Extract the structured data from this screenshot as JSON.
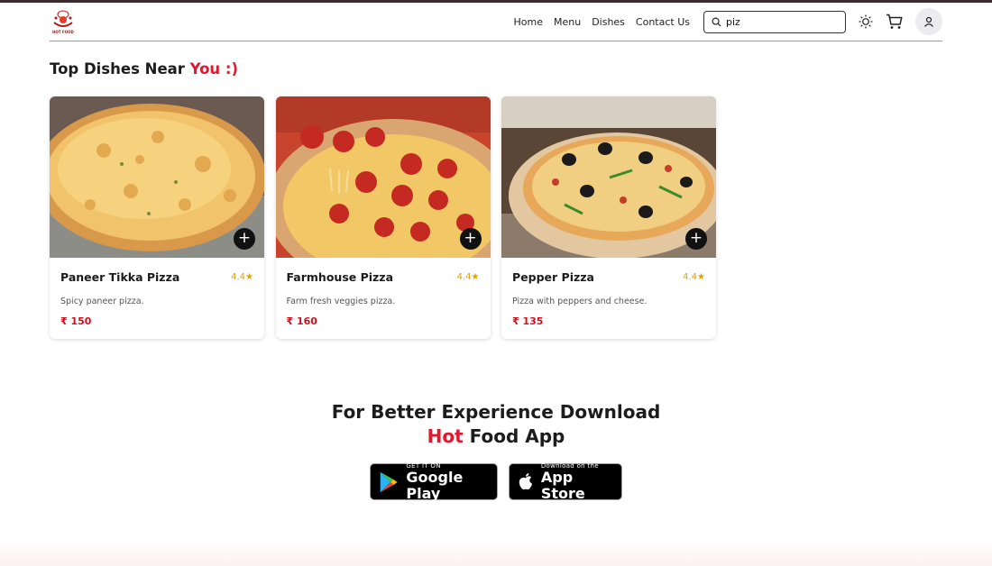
{
  "brand": {
    "logo_text": "HOT FOOD",
    "logo_icon": "chef-logo-icon"
  },
  "nav": {
    "links": [
      "Home",
      "Menu",
      "Dishes",
      "Contact Us"
    ],
    "search_value": "piz",
    "icons": [
      "search-icon",
      "sun-icon",
      "cart-icon",
      "user-icon"
    ]
  },
  "section": {
    "title_prefix": "Top Dishes Near",
    "title_accent": "You :)"
  },
  "dishes": [
    {
      "name": "Paneer Tikka Pizza",
      "rating": "4.4",
      "star": "★",
      "desc": "Spicy paneer pizza.",
      "price": "₹ 150"
    },
    {
      "name": "Farmhouse Pizza",
      "rating": "4.4",
      "star": "★",
      "desc": "Farm fresh veggies pizza.",
      "price": "₹ 160"
    },
    {
      "name": "Pepper Pizza",
      "rating": "4.4",
      "star": "★",
      "desc": "Pizza with peppers and cheese.",
      "price": "₹ 135"
    }
  ],
  "add_label": "+",
  "promo": {
    "line1": "For Better Experience Download",
    "line2_accent": "Hot",
    "line2_rest": "Food App"
  },
  "stores": {
    "google": {
      "small": "GET IT ON",
      "big": "Google Play"
    },
    "apple": {
      "small": "Download on the",
      "big": "App Store"
    }
  },
  "colors": {
    "accent": "#e0192e",
    "rating": "#e2a200",
    "price": "#d0101f"
  }
}
